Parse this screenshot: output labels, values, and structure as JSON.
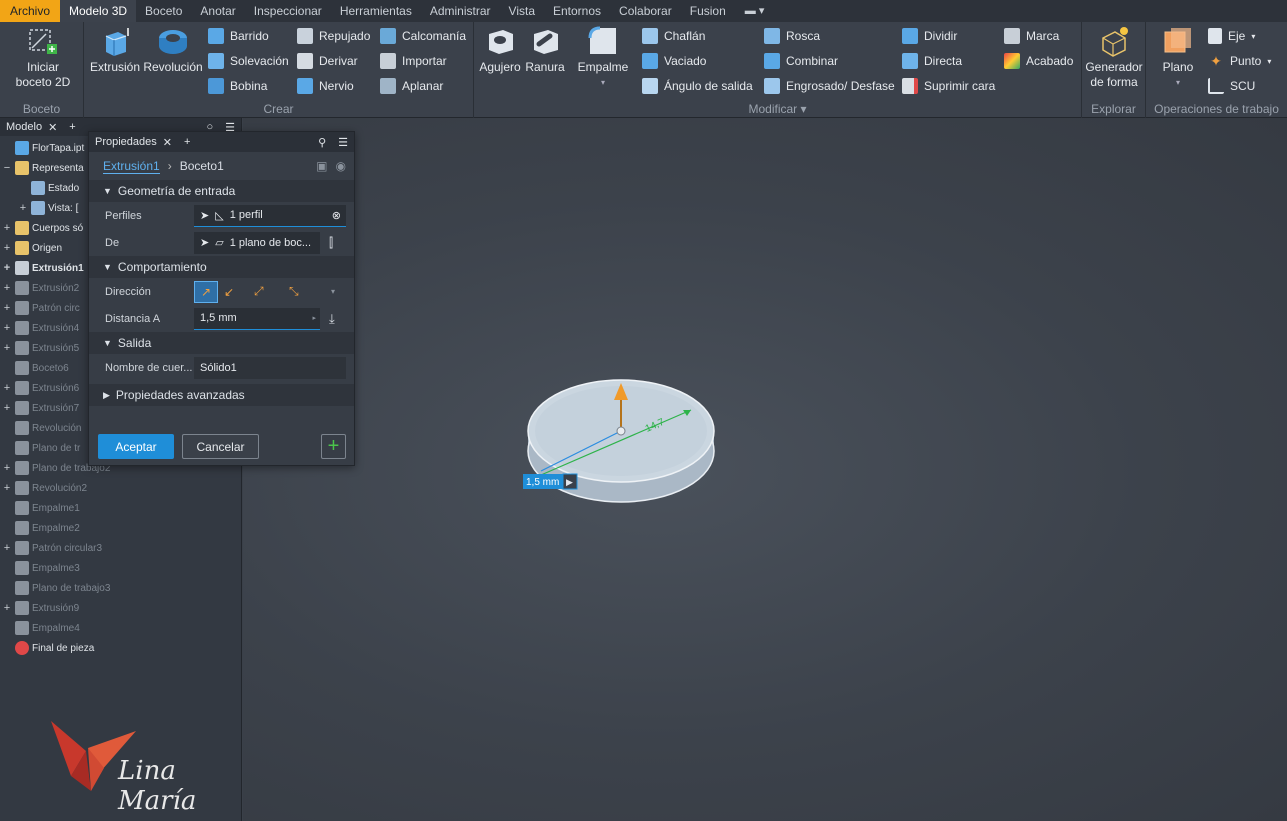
{
  "menu": {
    "file": "Archivo",
    "tabs": [
      "Modelo 3D",
      "Boceto",
      "Anotar",
      "Inspeccionar",
      "Herramientas",
      "Administrar",
      "Vista",
      "Entornos",
      "Colaborar",
      "Fusion"
    ]
  },
  "ribbon": {
    "boceto": {
      "title": "Boceto",
      "start_sketch": "Iniciar boceto 2D"
    },
    "crear": {
      "title": "Crear",
      "extrusion": "Extrusión",
      "revolucion": "Revolución",
      "barrido": "Barrido",
      "solevacion": "Solevación",
      "bobina": "Bobina",
      "repujado": "Repujado",
      "derivar": "Derivar",
      "nervio": "Nervio",
      "calcomania": "Calcomanía",
      "importar": "Importar",
      "aplanar": "Aplanar"
    },
    "modificar": {
      "title": "Modificar",
      "agujero": "Agujero",
      "ranura": "Ranura",
      "empalme": "Empalme",
      "chaflan": "Chaflán",
      "vaciado": "Vaciado",
      "angulo": "Ángulo de salida",
      "rosca": "Rosca",
      "combinar": "Combinar",
      "engrosado": "Engrosado/ Desfase",
      "dividir": "Dividir",
      "directa": "Directa",
      "suprimir": "Suprimir cara",
      "marca": "Marca",
      "acabado": "Acabado"
    },
    "explorar": {
      "title": "Explorar",
      "generador": "Generador de forma"
    },
    "operaciones": {
      "title": "Operaciones de trabajo",
      "plano": "Plano",
      "eje": "Eje",
      "punto": "Punto",
      "scu": "SCU"
    }
  },
  "browser": {
    "tab": "Modelo",
    "items": [
      {
        "label": "FlorTapa.ipt",
        "dim": false,
        "bold": false
      },
      {
        "label": "Representa",
        "dim": false,
        "bold": false
      },
      {
        "label": "Estado",
        "dim": false,
        "bold": false
      },
      {
        "label": "Vista: [",
        "dim": false,
        "bold": false
      },
      {
        "label": "Cuerpos só",
        "dim": false,
        "bold": false
      },
      {
        "label": "Origen",
        "dim": false,
        "bold": false
      },
      {
        "label": "Extrusión1",
        "dim": false,
        "bold": true
      },
      {
        "label": "Extrusión2",
        "dim": true,
        "bold": false
      },
      {
        "label": "Patrón circ",
        "dim": true,
        "bold": false
      },
      {
        "label": "Extrusión4",
        "dim": true,
        "bold": false
      },
      {
        "label": "Extrusión5",
        "dim": true,
        "bold": false
      },
      {
        "label": "Boceto6",
        "dim": true,
        "bold": false
      },
      {
        "label": "Extrusión6",
        "dim": true,
        "bold": false
      },
      {
        "label": "Extrusión7",
        "dim": true,
        "bold": false
      },
      {
        "label": "Revolución",
        "dim": true,
        "bold": false
      },
      {
        "label": "Plano de tr",
        "dim": true,
        "bold": false
      },
      {
        "label": "Plano de trabajo2",
        "dim": true,
        "bold": false
      },
      {
        "label": "Revolución2",
        "dim": true,
        "bold": false
      },
      {
        "label": "Empalme1",
        "dim": true,
        "bold": false
      },
      {
        "label": "Empalme2",
        "dim": true,
        "bold": false
      },
      {
        "label": "Patrón circular3",
        "dim": true,
        "bold": false
      },
      {
        "label": "Empalme3",
        "dim": true,
        "bold": false
      },
      {
        "label": "Plano de trabajo3",
        "dim": true,
        "bold": false
      },
      {
        "label": "Extrusión9",
        "dim": true,
        "bold": false
      },
      {
        "label": "Empalme4",
        "dim": true,
        "bold": false
      },
      {
        "label": "Final de pieza",
        "dim": false,
        "bold": false
      }
    ]
  },
  "props": {
    "tab": "Propiedades",
    "crumb_feature": "Extrusión1",
    "crumb_sketch": "Boceto1",
    "sec_input": "Geometría de entrada",
    "perfiles_label": "Perfiles",
    "perfiles_value": "1 perfil",
    "de_label": "De",
    "de_value": "1 plano de boc...",
    "sec_behavior": "Comportamiento",
    "direccion_label": "Dirección",
    "distancia_label": "Distancia A",
    "distancia_value": "1,5 mm",
    "sec_output": "Salida",
    "nombre_label": "Nombre de cuer...",
    "nombre_value": "Sólido1",
    "sec_advanced": "Propiedades avanzadas",
    "accept": "Aceptar",
    "cancel": "Cancelar"
  },
  "viewport": {
    "dim_value": "14,7",
    "distance_tag": "1,5 mm"
  },
  "watermark": "Lina María"
}
